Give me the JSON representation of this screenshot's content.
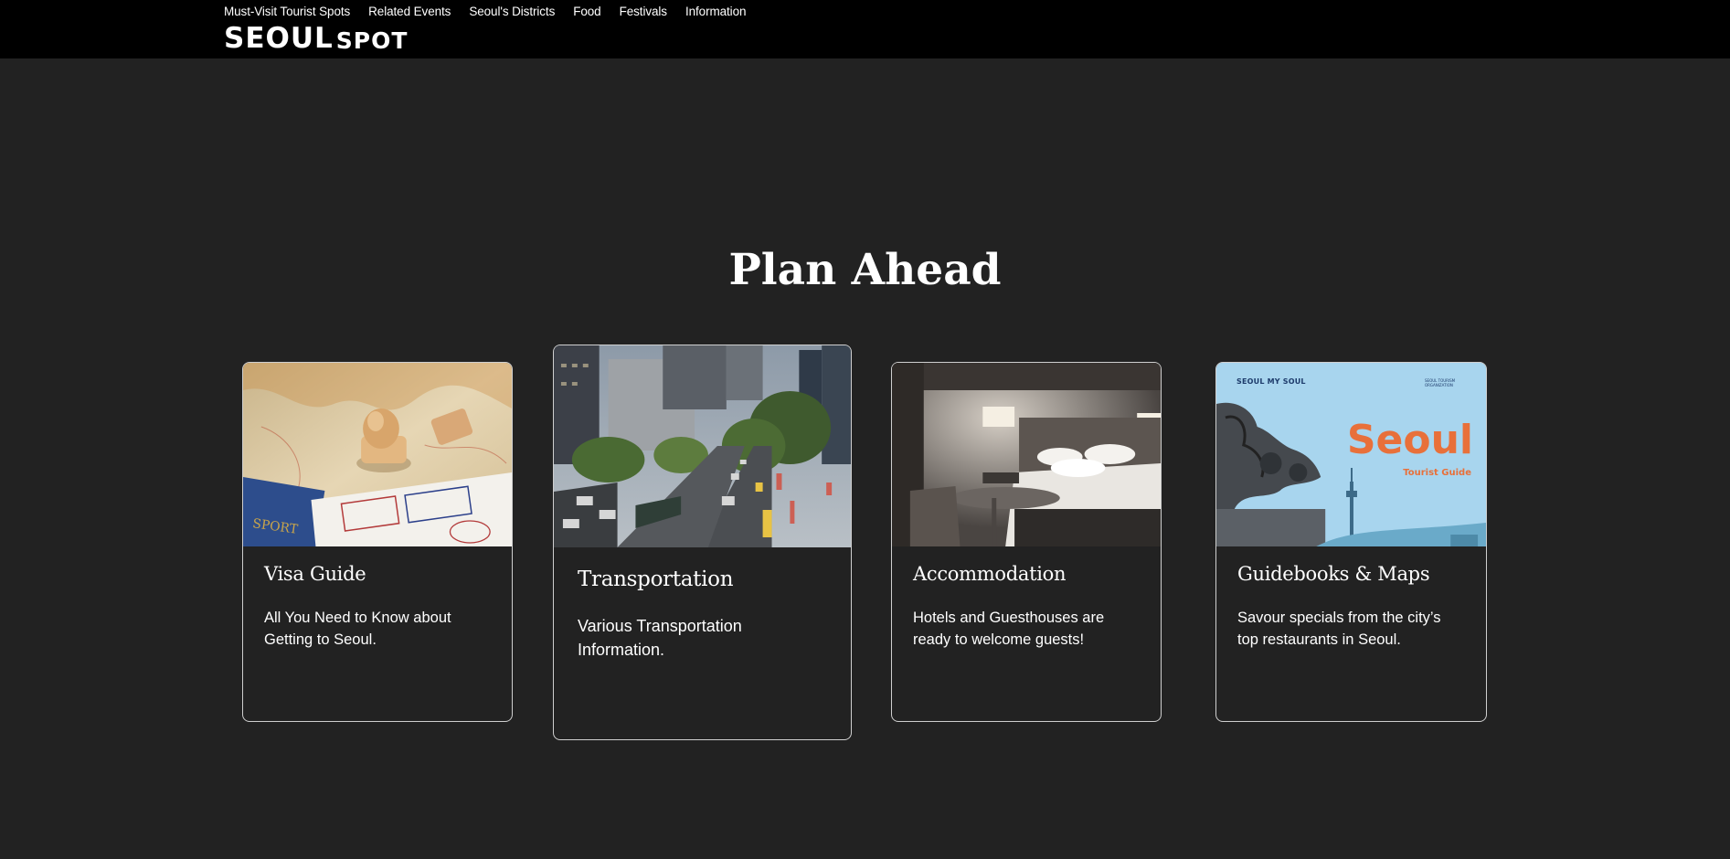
{
  "nav": {
    "items": [
      "Must-Visit Tourist Spots",
      "Related Events",
      "Seoul's Districts",
      "Food",
      "Festivals",
      "Information"
    ]
  },
  "logo": {
    "part1": "SEOUL",
    "part2": "SPOT"
  },
  "section": {
    "title": "Plan Ahead"
  },
  "cards": [
    {
      "title": "Visa Guide",
      "description": "All You Need to Know about Getting to Seoul.",
      "image": "passport-stamp-photo"
    },
    {
      "title": "Transportation",
      "description": "Various Transportation Information.",
      "image": "city-street-traffic-photo"
    },
    {
      "title": "Accommodation",
      "description": "Hotels and Guesthouses are ready to welcome guests!",
      "image": "hotel-room-photo"
    },
    {
      "title": "Guidebooks & Maps",
      "description": "Savour specials from the city’s top restaurants in Seoul.",
      "image": "seoul-guidebook-cover",
      "cover": {
        "brand": "SEOUL MY SOUL",
        "title": "Seoul",
        "subtitle": "Tourist Guide",
        "org": "SEOUL TOURISM ORGANIZATION"
      }
    }
  ],
  "colors": {
    "background": "#222222",
    "header": "#000000",
    "text": "#ffffff",
    "card_border": "#cfcfcf",
    "guide_accent": "#e8703a"
  }
}
